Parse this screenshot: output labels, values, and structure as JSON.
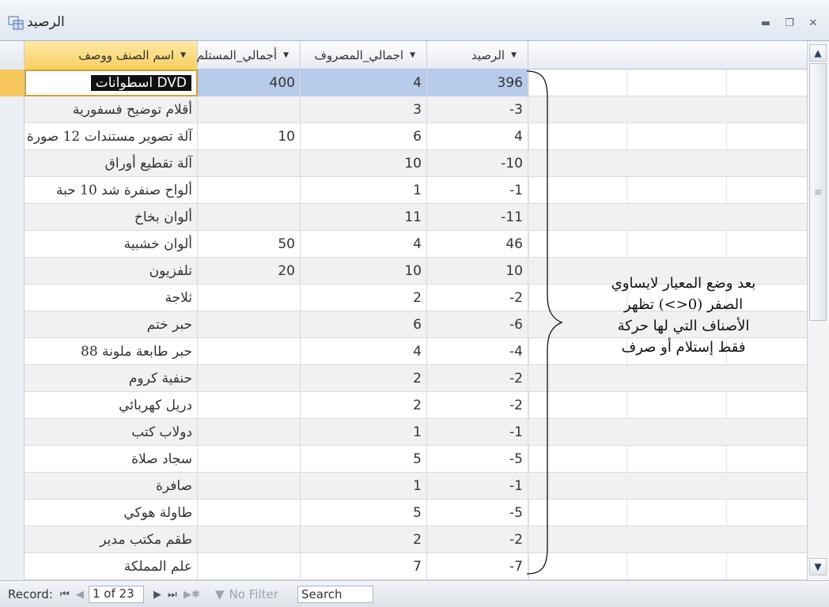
{
  "window": {
    "title": "الرصيد",
    "controls": [
      "minimize-icon",
      "restore-icon",
      "close-icon"
    ]
  },
  "table": {
    "headers": {
      "name": "اسم الصنف ووصف",
      "received": "أجمالي_المستلم",
      "spent": "اجمالي_المصروف",
      "balance": "الرصيد"
    },
    "rows": [
      {
        "name": "اسطوانات DVD",
        "received": "400",
        "spent": "4",
        "balance": "396"
      },
      {
        "name": "أقلام توضيح فسفورية",
        "received": "",
        "spent": "3",
        "balance": "-3"
      },
      {
        "name": "آلة تصوير مستندات 12 صورة",
        "received": "10",
        "spent": "6",
        "balance": "4"
      },
      {
        "name": "آلة تقطيع أوراق",
        "received": "",
        "spent": "10",
        "balance": "-10"
      },
      {
        "name": "ألواح صنفرة شد 10 حبة",
        "received": "",
        "spent": "1",
        "balance": "-1"
      },
      {
        "name": "ألوان بخاخ",
        "received": "",
        "spent": "11",
        "balance": "-11"
      },
      {
        "name": "ألوان خشبية",
        "received": "50",
        "spent": "4",
        "balance": "46"
      },
      {
        "name": "تلفزيون",
        "received": "20",
        "spent": "10",
        "balance": "10"
      },
      {
        "name": "ثلاجة",
        "received": "",
        "spent": "2",
        "balance": "-2"
      },
      {
        "name": "حبر ختم",
        "received": "",
        "spent": "6",
        "balance": "-6"
      },
      {
        "name": "حبر طابعة ملونة 88",
        "received": "",
        "spent": "4",
        "balance": "-4"
      },
      {
        "name": "حنفية كروم",
        "received": "",
        "spent": "2",
        "balance": "-2"
      },
      {
        "name": "دريل كهربائي",
        "received": "",
        "spent": "2",
        "balance": "-2"
      },
      {
        "name": "دولاب كتب",
        "received": "",
        "spent": "1",
        "balance": "-1"
      },
      {
        "name": "سجاد صلاة",
        "received": "",
        "spent": "5",
        "balance": "-5"
      },
      {
        "name": "صافرة",
        "received": "",
        "spent": "1",
        "balance": "-1"
      },
      {
        "name": "طاولة هوكي",
        "received": "",
        "spent": "5",
        "balance": "-5"
      },
      {
        "name": "طقم مكتب مدير",
        "received": "",
        "spent": "2",
        "balance": "-2"
      },
      {
        "name": "علم المملكة",
        "received": "",
        "spent": "7",
        "balance": "-7"
      }
    ]
  },
  "annotation": {
    "lines": [
      "بعد وضع المعيار لايساوي",
      "الصفر (0<>) تظهر",
      "الأصناف التي لها حركة",
      "فقط إستلام أو صرف"
    ]
  },
  "statusbar": {
    "record_label": "Record:",
    "record_value": "1 of 23",
    "filter_label": "No Filter",
    "search_label": "Search"
  },
  "colors": {
    "active_header": "#f7cf5e",
    "selected_row": "#b7cbea"
  }
}
